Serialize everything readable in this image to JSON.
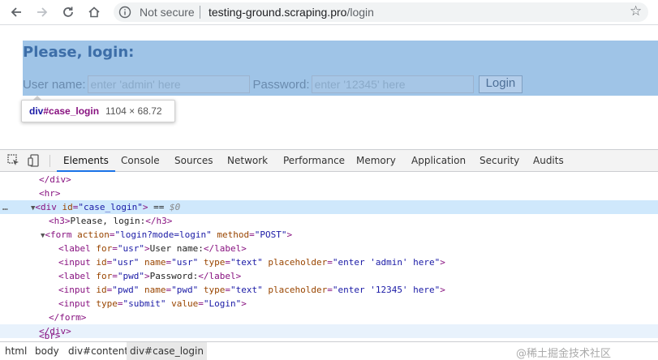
{
  "toolbar": {
    "secure_label": "Not secure",
    "url_host": "testing-ground.scraping.pro",
    "url_path": "/login"
  },
  "page": {
    "heading": "Please, login:",
    "user_label": "User name:",
    "user_placeholder": "enter 'admin' here",
    "password_label": "Password:",
    "password_placeholder": "enter '12345' here",
    "login_button": "Login"
  },
  "tooltip": {
    "selector_tag": "div",
    "selector_id": "#case_login",
    "dimensions": "1104 × 68.72"
  },
  "devtools": {
    "tabs": [
      "Elements",
      "Console",
      "Sources",
      "Network",
      "Performance",
      "Memory",
      "Application",
      "Security",
      "Audits"
    ],
    "active_tab": "Elements",
    "breadcrumbs": [
      "html",
      "body",
      "div#content",
      "div#case_login"
    ],
    "watermark": "@稀土掘金技术社区"
  }
}
